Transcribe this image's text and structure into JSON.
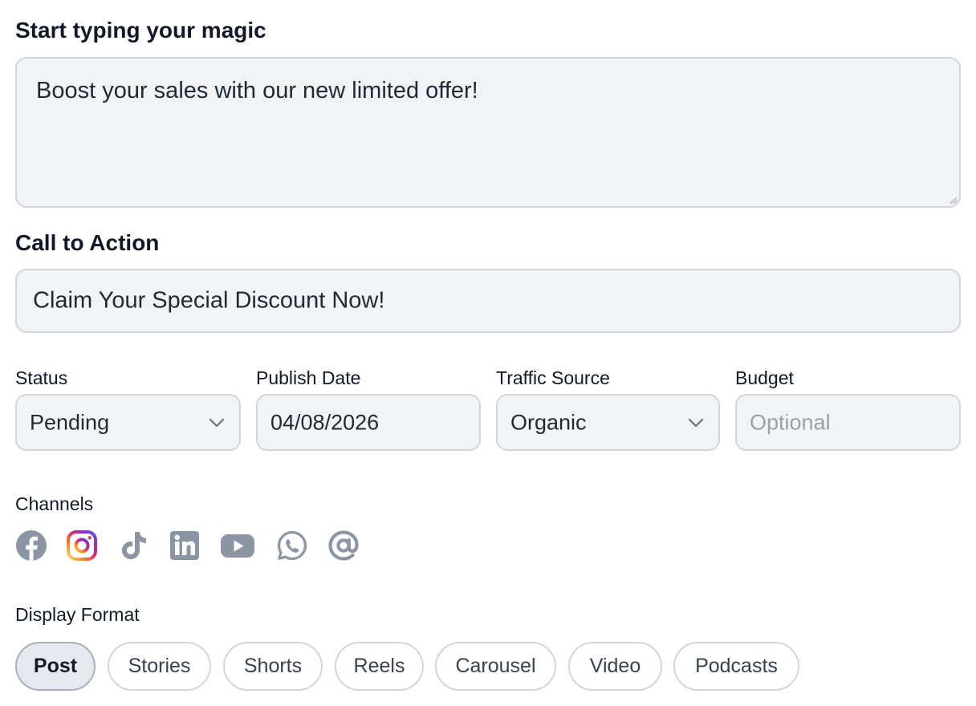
{
  "message": {
    "label": "Start typing your magic",
    "value": "Boost your sales with our new limited offer!"
  },
  "cta": {
    "label": "Call to Action",
    "value": "Claim Your Special Discount Now!"
  },
  "status": {
    "label": "Status",
    "value": "Pending"
  },
  "publish_date": {
    "label": "Publish Date",
    "value": "04/08/2026"
  },
  "traffic_source": {
    "label": "Traffic Source",
    "value": "Organic"
  },
  "budget": {
    "label": "Budget",
    "placeholder": "Optional",
    "value": ""
  },
  "channels": {
    "label": "Channels",
    "items": [
      {
        "name": "facebook-icon",
        "selected": false
      },
      {
        "name": "instagram-icon",
        "selected": true
      },
      {
        "name": "tiktok-icon",
        "selected": false
      },
      {
        "name": "linkedin-icon",
        "selected": false
      },
      {
        "name": "youtube-icon",
        "selected": false
      },
      {
        "name": "whatsapp-icon",
        "selected": false
      },
      {
        "name": "threads-icon",
        "selected": false
      }
    ],
    "inactive_color": "#8b95a3"
  },
  "display_format": {
    "label": "Display Format",
    "selected": "Post",
    "options": [
      "Post",
      "Stories",
      "Shorts",
      "Reels",
      "Carousel",
      "Video",
      "Podcasts"
    ]
  }
}
